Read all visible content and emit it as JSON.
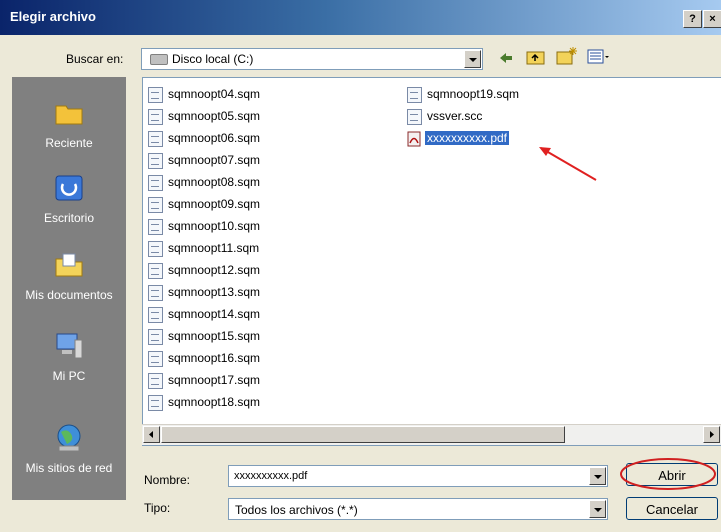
{
  "window": {
    "title": "Elegir archivo",
    "help_label": "?",
    "close_label": "×"
  },
  "lookin": {
    "label": "Buscar en:",
    "value": "Disco local (C:)"
  },
  "places": [
    {
      "label": "Reciente",
      "icon": "recent-folder-icon"
    },
    {
      "label": "Escritorio",
      "icon": "desktop-icon"
    },
    {
      "label": "Mis documentos",
      "icon": "my-documents-icon"
    },
    {
      "label": "Mi PC",
      "icon": "my-computer-icon"
    },
    {
      "label": "Mis sitios de red",
      "icon": "network-places-icon"
    }
  ],
  "files_col1": [
    "sqmnoopt04.sqm",
    "sqmnoopt05.sqm",
    "sqmnoopt06.sqm",
    "sqmnoopt07.sqm",
    "sqmnoopt08.sqm",
    "sqmnoopt09.sqm",
    "sqmnoopt10.sqm",
    "sqmnoopt11.sqm",
    "sqmnoopt12.sqm",
    "sqmnoopt13.sqm",
    "sqmnoopt14.sqm",
    "sqmnoopt15.sqm",
    "sqmnoopt16.sqm",
    "sqmnoopt17.sqm",
    "sqmnoopt18.sqm"
  ],
  "files_col2": [
    "sqmnoopt19.sqm",
    "vssver.scc",
    "xxxxxxxxxx.pdf"
  ],
  "selected_file": "xxxxxxxxxx.pdf",
  "filename": {
    "label": "Nombre:",
    "value": "xxxxxxxxxx.pdf"
  },
  "filetype": {
    "label": "Tipo:",
    "value": "Todos los archivos (*.*)"
  },
  "buttons": {
    "open": "Abrir",
    "cancel": "Cancelar"
  },
  "colors": {
    "accent": "#316ac5",
    "annotation": "#e02020"
  }
}
